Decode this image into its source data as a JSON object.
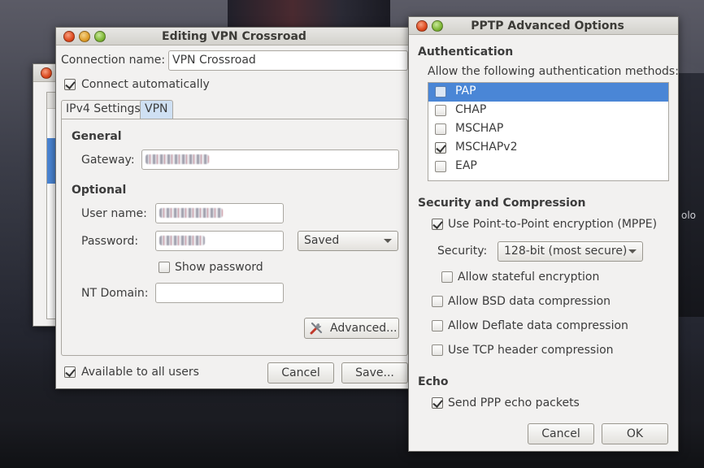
{
  "desktop": {
    "building_text": "olo"
  },
  "editor": {
    "title": "Editing VPN Crossroad",
    "connection_name_label": "Connection name:",
    "connection_name_value": "VPN Crossroad",
    "connect_auto_label": "Connect automatically",
    "connect_auto_checked": true,
    "tabs": [
      {
        "label": "IPv4 Settings",
        "active": true
      },
      {
        "label": "VPN",
        "active": false
      }
    ],
    "general_heading": "General",
    "gateway_label": "Gateway:",
    "optional_heading": "Optional",
    "username_label": "User name:",
    "password_label": "Password:",
    "password_storage": "Saved",
    "show_password_label": "Show password",
    "nt_domain_label": "NT Domain:",
    "nt_domain_value": "",
    "advanced_button": "Advanced...",
    "available_all_label": "Available to all users",
    "available_all_checked": true,
    "cancel_button": "Cancel",
    "save_button": "Save..."
  },
  "pptp": {
    "title": "PPTP Advanced Options",
    "auth_heading": "Authentication",
    "auth_subheading": "Allow the following authentication methods:",
    "auth_methods": [
      {
        "label": "PAP",
        "checked": false,
        "selected": true
      },
      {
        "label": "CHAP",
        "checked": false,
        "selected": false
      },
      {
        "label": "MSCHAP",
        "checked": false,
        "selected": false
      },
      {
        "label": "MSCHAPv2",
        "checked": true,
        "selected": false
      },
      {
        "label": "EAP",
        "checked": false,
        "selected": false
      }
    ],
    "security_heading": "Security and Compression",
    "mppe_label": "Use Point-to-Point encryption (MPPE)",
    "mppe_checked": true,
    "security_label": "Security:",
    "security_value": "128-bit (most secure)",
    "stateful_label": "Allow stateful encryption",
    "bsd_label": "Allow BSD data compression",
    "deflate_label": "Allow Deflate data compression",
    "tcp_label": "Use TCP header compression",
    "echo_heading": "Echo",
    "echo_label": "Send PPP echo packets",
    "echo_checked": true,
    "cancel_button": "Cancel",
    "ok_button": "OK"
  }
}
